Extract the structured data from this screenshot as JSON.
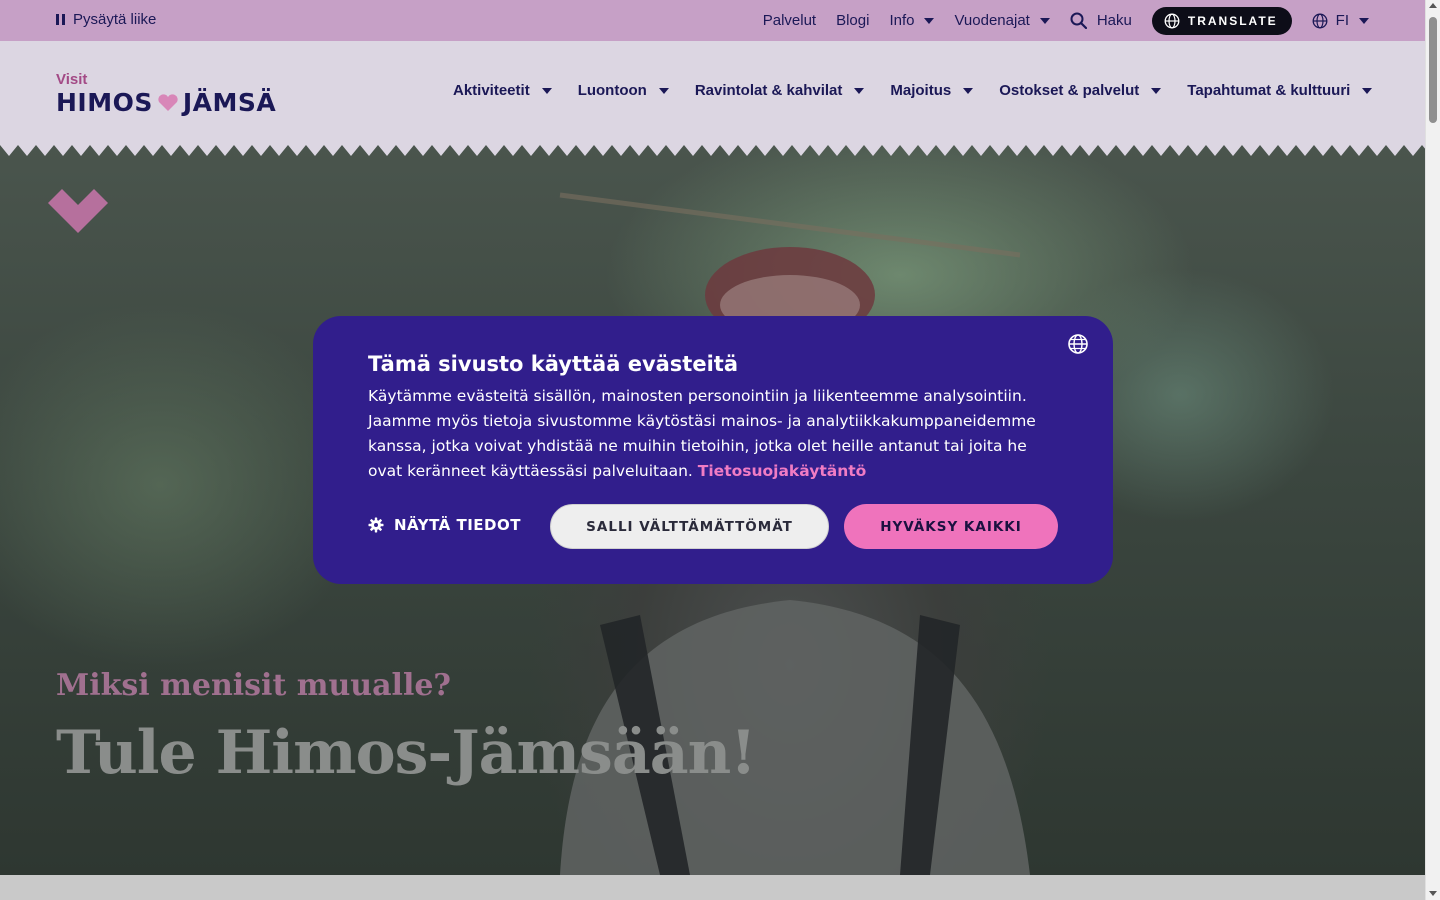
{
  "topbar": {
    "pause_label": "Pysäytä liike",
    "links": [
      "Palvelut",
      "Blogi",
      "Info",
      "Vuodenajat"
    ],
    "search_label": "Haku",
    "translate_label": "TRANSLATE",
    "language": "FI"
  },
  "logo": {
    "visit": "Visit",
    "himos": "HIMOS",
    "jamsa": "JÄMSÄ"
  },
  "nav": [
    "Aktiviteetit",
    "Luontoon",
    "Ravintolat & kahvilat",
    "Majoitus",
    "Ostokset & palvelut",
    "Tapahtumat & kulttuuri"
  ],
  "hero": {
    "kicker": "Miksi menisit muualle?",
    "title": "Tule Himos-Jämsään!"
  },
  "cookie": {
    "title": "Tämä sivusto käyttää evästeitä",
    "body": "Käytämme evästeitä sisällön, mainosten personointiin ja liikenteemme analysointiin. Jaamme myös tietoja sivustomme käytöstäsi mainos- ja analytiikkakumppaneidemme kanssa, jotka voivat yhdistää ne muihin tietoihin, jotka olet heille antanut tai joita he ovat keränneet käyttäessäsi palveluitaan.",
    "policy_link": "Tietosuojakäytäntö",
    "details_label": "NÄYTÄ TIEDOT",
    "necessary_label": "SALLI VÄLTTÄMÄTTÖMÄT",
    "accept_label": "HYVÄKSY KAIKKI"
  },
  "colors": {
    "topbar_bg": "#c6a0c6",
    "navy": "#1b1856",
    "cookie_bg": "#311e8c",
    "accent_pink": "#ef73bc"
  }
}
